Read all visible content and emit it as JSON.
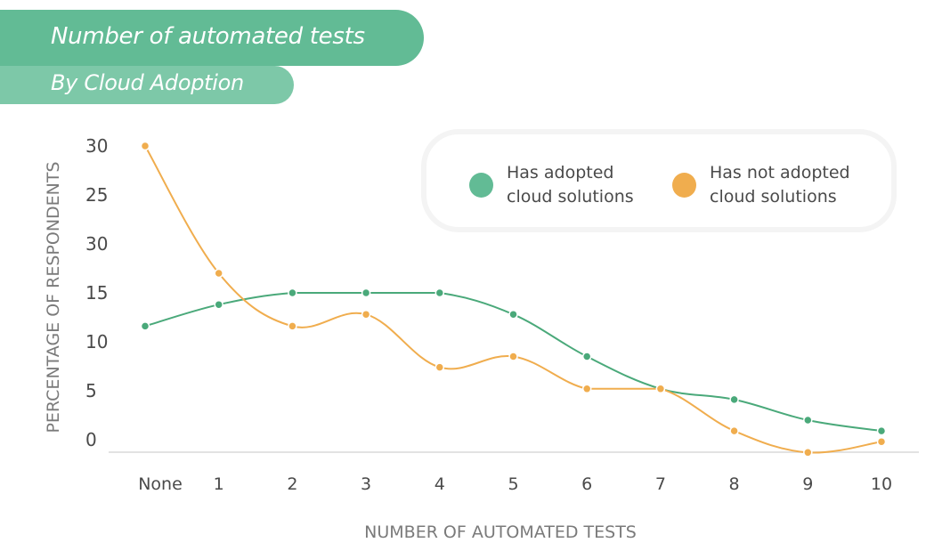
{
  "header": {
    "title": "Number of automated tests",
    "subtitle": "By Cloud Adoption"
  },
  "legend": [
    {
      "label_line1": "Has adopted",
      "label_line2": "cloud solutions",
      "color": "#62bb95"
    },
    {
      "label_line1": "Has not adopted",
      "label_line2": "cloud solutions",
      "color": "#f0ad4e"
    }
  ],
  "chart_data": {
    "type": "line",
    "title": "Number of automated tests",
    "subtitle": "By Cloud Adoption",
    "xlabel": "NUMBER OF AUTOMATED TESTS",
    "ylabel": "PERCENTAGE OF RESPONDENTS",
    "categories": [
      "None",
      "1",
      "2",
      "3",
      "4",
      "5",
      "6",
      "7",
      "8",
      "9",
      "10"
    ],
    "y_tick_values": [
      30,
      25,
      20,
      15,
      10,
      5,
      0
    ],
    "y_tick_labels": [
      "30",
      "25",
      "30",
      "15",
      "10",
      "5",
      "0"
    ],
    "ylim": [
      0,
      30
    ],
    "grid": false,
    "legend_position": "top-right",
    "series": [
      {
        "name": "Has adopted cloud solutions",
        "color": "#4aa97a",
        "values": [
          11.6,
          13.8,
          15,
          15,
          15,
          12.8,
          8.5,
          5.2,
          4.1,
          2.0,
          0.9
        ]
      },
      {
        "name": "Has not adopted cloud solutions",
        "color": "#f0ad4e",
        "values": [
          30,
          17,
          11.6,
          12.8,
          7.4,
          8.5,
          5.2,
          5.2,
          0.9,
          -1.3,
          -0.2
        ]
      }
    ]
  }
}
